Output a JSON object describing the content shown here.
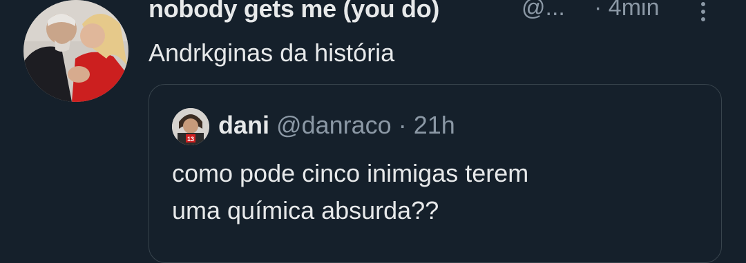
{
  "tweet": {
    "display_name": "nobody gets me (you do)",
    "handle": "@...",
    "separator": "·",
    "time": "4min",
    "text": "Andrkginas da história",
    "avatar_icon": "profile-photo",
    "more_icon": "vertical-ellipsis-icon"
  },
  "quote": {
    "display_name": "dani",
    "handle": "@danraco",
    "separator": "·",
    "time": "21h",
    "text_line1": "como pode cinco inimigas terem",
    "text_line2": "uma química absurda??",
    "avatar_icon": "profile-photo"
  },
  "colors": {
    "background": "#15202b",
    "primary_text": "#e7e9ea",
    "secondary_text": "#8b98a5",
    "border": "#38444d"
  }
}
